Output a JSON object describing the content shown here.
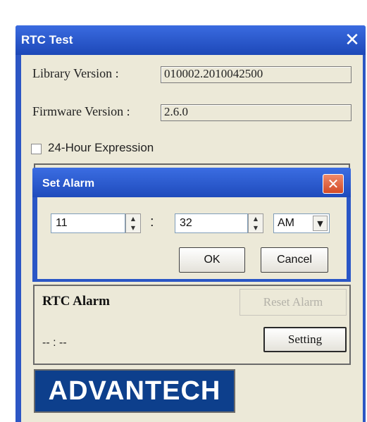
{
  "window": {
    "title": "RTC Test",
    "close_glyph": "✕",
    "accent_color": "#2c56c4"
  },
  "info": {
    "library_label": "Library Version :",
    "library_value": "010002.2010042500",
    "firmware_label": "Firmware Version :",
    "firmware_value": "2.6.0"
  },
  "options": {
    "hour24_label": "24-Hour Expression",
    "hour24_checked": false
  },
  "set_alarm_dialog": {
    "title": "Set Alarm",
    "close_glyph": "✕",
    "close_color": "#d34a26",
    "hour": "11",
    "separator": ":",
    "minute": "32",
    "ampm": "AM",
    "ok_label": "OK",
    "cancel_label": "Cancel"
  },
  "rtc_alarm": {
    "title": "RTC Alarm",
    "reset_label": "Reset Alarm",
    "reset_enabled": false,
    "time_display": "-- : --",
    "setting_label": "Setting"
  },
  "logo": {
    "text": "ADVANTECH",
    "color": "#0d3f8c"
  }
}
